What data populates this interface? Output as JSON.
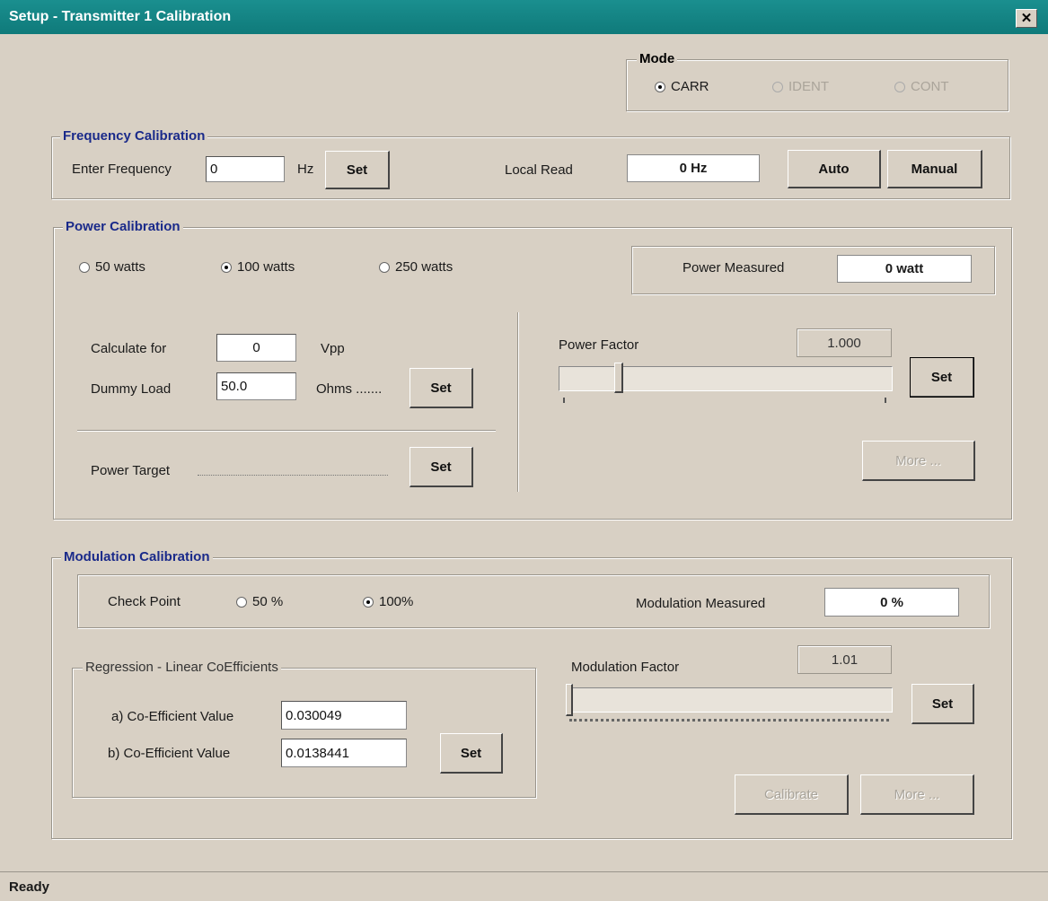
{
  "window": {
    "title": "Setup - Transmitter 1 Calibration",
    "close_symbol": "✕"
  },
  "mode": {
    "legend": "Mode",
    "options": [
      {
        "label": "CARR",
        "selected": true,
        "enabled": true
      },
      {
        "label": "IDENT",
        "selected": false,
        "enabled": false
      },
      {
        "label": "CONT",
        "selected": false,
        "enabled": false
      }
    ]
  },
  "frequency": {
    "legend": "Frequency Calibration",
    "enter_label": "Enter Frequency",
    "value": "0",
    "unit": "Hz",
    "set_label": "Set",
    "local_read_label": "Local Read",
    "local_read_value": "0 Hz",
    "auto_label": "Auto",
    "manual_label": "Manual"
  },
  "power": {
    "legend": "Power Calibration",
    "options": [
      {
        "label": "50 watts",
        "selected": false
      },
      {
        "label": "100 watts",
        "selected": true
      },
      {
        "label": "250 watts",
        "selected": false
      }
    ],
    "measured_label": "Power Measured",
    "measured_value": "0 watt",
    "calculate_label": "Calculate for",
    "calculate_value": "0",
    "calculate_unit": "Vpp",
    "dummy_label": "Dummy Load",
    "dummy_value": "50.0",
    "dummy_unit": "Ohms .......",
    "dummy_set_label": "Set",
    "target_label": "Power Target",
    "target_set_label": "Set",
    "factor_label": "Power Factor",
    "factor_value": "1.000",
    "factor_set_label": "Set",
    "more_label": "More ..."
  },
  "modulation": {
    "legend": "Modulation Calibration",
    "checkpoint_label": "Check Point",
    "options": [
      {
        "label": "50 %",
        "selected": false
      },
      {
        "label": "100%",
        "selected": true
      }
    ],
    "measured_label": "Modulation Measured",
    "measured_value": "0 %",
    "regression_legend": "Regression - Linear CoEfficients",
    "coeff_a_label": "a) Co-Efficient Value",
    "coeff_a_value": "0.030049",
    "coeff_b_label": "b) Co-Efficient Value",
    "coeff_b_value": "0.0138441",
    "coeff_set_label": "Set",
    "factor_label": "Modulation Factor",
    "factor_value": "1.01",
    "factor_set_label": "Set",
    "calibrate_label": "Calibrate",
    "more_label": "More ..."
  },
  "status": {
    "text": "Ready"
  }
}
